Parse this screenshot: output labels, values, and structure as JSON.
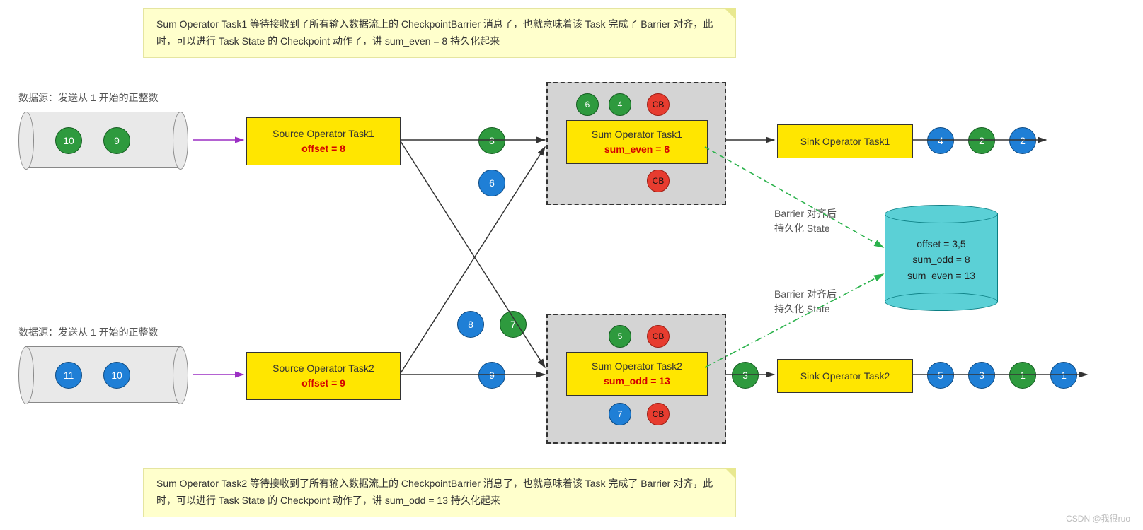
{
  "notes": {
    "top": "Sum Operator Task1 等待接收到了所有输入数据流上的 CheckpointBarrier 消息了，也就意味着该 Task 完成了 Barrier 对齐，此时，可以进行 Task State 的 Checkpoint 动作了，讲 sum_even = 8 持久化起来",
    "bottom": "Sum Operator Task2 等待接收到了所有输入数据流上的 CheckpointBarrier 消息了，也就意味着该 Task 完成了 Barrier 对齐，此时，可以进行 Task State 的 Checkpoint 动作了，讲 sum_odd = 13 持久化起来"
  },
  "dataSourceLabel": "数据源：发送从 1 开始的正整数",
  "source1": {
    "title": "Source Operator Task1",
    "state": "offset = 8"
  },
  "source2": {
    "title": "Source Operator Task2",
    "state": "offset = 9"
  },
  "sum1": {
    "title": "Sum Operator Task1",
    "state": "sum_even = 8"
  },
  "sum2": {
    "title": "Sum Operator Task2",
    "state": "sum_odd = 13"
  },
  "sink1": "Sink Operator Task1",
  "sink2": "Sink Operator Task2",
  "barrierLabel1": "Barrier 对齐后\n持久化 State",
  "barrierLabel2": "Barrier 对齐后\n持久化 State",
  "store": {
    "l1": "offset = 3,5",
    "l2": "sum_odd = 8",
    "l3": "sum_even = 13"
  },
  "cyl1": {
    "a": "10",
    "b": "9"
  },
  "cyl2": {
    "a": "11",
    "b": "10"
  },
  "mid": {
    "e8": "8",
    "e6": "6",
    "b8": "8",
    "g7": "7",
    "b9": "9"
  },
  "buf1": {
    "a": "6",
    "b": "4",
    "cb": "CB",
    "cb2": "CB"
  },
  "buf2": {
    "a": "5",
    "cb": "CB",
    "b7": "7",
    "cb2": "CB"
  },
  "out": {
    "g3": "3"
  },
  "sinkOut1": {
    "a": "4",
    "b": "2",
    "c": "2"
  },
  "sinkOut2": {
    "a": "5",
    "b": "3",
    "c": "1",
    "d": "1"
  },
  "watermark": "CSDN @我很ruo"
}
